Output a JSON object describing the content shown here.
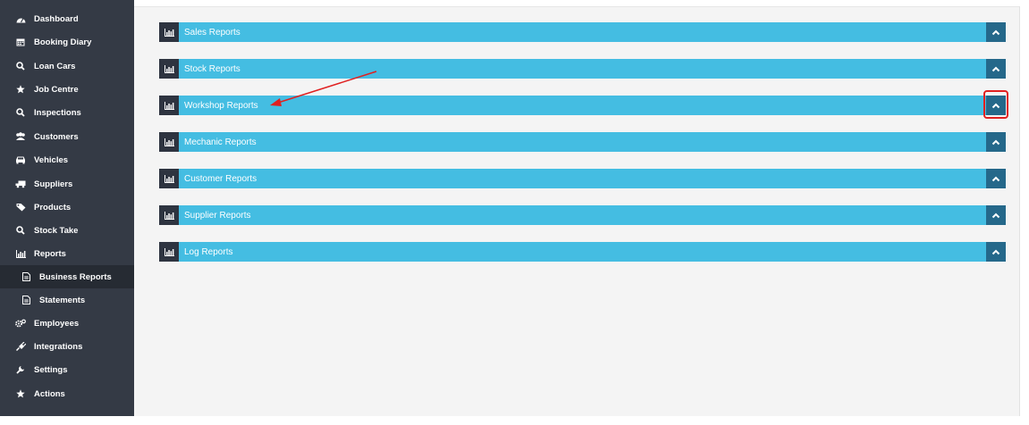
{
  "sidebar": {
    "items": [
      {
        "label": "Dashboard",
        "icon": "dashboard-icon"
      },
      {
        "label": "Booking Diary",
        "icon": "calendar-icon"
      },
      {
        "label": "Loan Cars",
        "icon": "search-icon"
      },
      {
        "label": "Job Centre",
        "icon": "star-icon"
      },
      {
        "label": "Inspections",
        "icon": "search-icon"
      },
      {
        "label": "Customers",
        "icon": "users-icon"
      },
      {
        "label": "Vehicles",
        "icon": "car-icon"
      },
      {
        "label": "Suppliers",
        "icon": "truck-icon"
      },
      {
        "label": "Products",
        "icon": "tag-icon"
      },
      {
        "label": "Stock Take",
        "icon": "search-icon"
      },
      {
        "label": "Reports",
        "icon": "bar-chart-icon"
      },
      {
        "label": "Business Reports",
        "icon": "document-icon",
        "active": true
      },
      {
        "label": "Statements",
        "icon": "document-icon"
      },
      {
        "label": "Employees",
        "icon": "cogs-icon"
      },
      {
        "label": "Integrations",
        "icon": "plug-icon"
      },
      {
        "label": "Settings",
        "icon": "wrench-icon"
      },
      {
        "label": "Actions",
        "icon": "star-icon"
      }
    ]
  },
  "report_panels": [
    {
      "title": "Sales Reports",
      "icon": "bar-chart-icon",
      "toggle_icon": "chevron-up-icon"
    },
    {
      "title": "Stock Reports",
      "icon": "bar-chart-icon",
      "toggle_icon": "chevron-up-icon"
    },
    {
      "title": "Workshop Reports",
      "icon": "bar-chart-icon",
      "toggle_icon": "chevron-up-icon"
    },
    {
      "title": "Mechanic Reports",
      "icon": "bar-chart-icon",
      "toggle_icon": "chevron-up-icon"
    },
    {
      "title": "Customer Reports",
      "icon": "bar-chart-icon",
      "toggle_icon": "chevron-up-icon"
    },
    {
      "title": "Supplier Reports",
      "icon": "bar-chart-icon",
      "toggle_icon": "chevron-up-icon"
    },
    {
      "title": "Log Reports",
      "icon": "bar-chart-icon",
      "toggle_icon": "chevron-up-icon"
    }
  ],
  "colors": {
    "sidebar_bg": "#343a45",
    "panel_bar": "#44bde2",
    "toggle_bg": "#25688a",
    "annotation": "#e02020"
  }
}
